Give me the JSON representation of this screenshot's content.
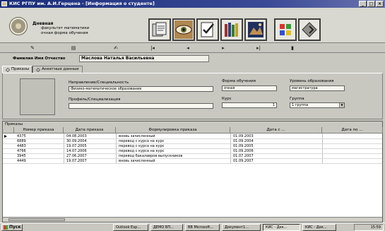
{
  "window": {
    "title": "КИС РГПУ им. А.И.Герцена - [Информация о студенте]",
    "controls": [
      "_",
      "□",
      "×"
    ]
  },
  "header": {
    "line1": "Дневная",
    "line2": "факультет математики",
    "line3": "очная форма обучения",
    "nav_icons": [
      "documents-icon",
      "eye-icon",
      "check-form-icon",
      "books-icon",
      "painting-icon",
      "windows-icon",
      "navigate-icon"
    ]
  },
  "toolbar": {
    "buttons": [
      "edit-record-icon",
      "print-icon",
      "sign-icon",
      "first-record-icon",
      "prev-record-icon",
      "next-record-icon",
      "last-record-icon",
      "delete-record-icon"
    ]
  },
  "student": {
    "fio_label": "Фамилия Имя Отчество",
    "fio_value": "Маслова Наталья Васильевна"
  },
  "tabs": [
    {
      "label": "Приказы",
      "active": true
    },
    {
      "label": "Анкетные данные",
      "active": false
    }
  ],
  "form": {
    "direction_label": "Направление/Специальность",
    "direction_value": "Физико-математическое образование",
    "profile_label": "Профиль/Специализация",
    "profile_value": "",
    "study_form_label": "Форма обучения",
    "study_form_value": "очная",
    "course_label": "Курс",
    "course_value": "1",
    "level_label": "Уровень образования",
    "level_value": "магистратура",
    "group_label": "Группа",
    "group_value": "1 группа"
  },
  "orders": {
    "title": "Приказы",
    "columns": [
      "Номер приказа",
      "Дата приказа",
      "Формулировка приказа",
      "Дата с ...",
      "Дата по ..."
    ],
    "rows": [
      {
        "num": "4375",
        "date": "04.08.2003",
        "text": "вновь зачисленный",
        "from": "01.09.2003",
        "to": "",
        "current": true
      },
      {
        "num": "6889",
        "date": "30.09.2004",
        "text": "перевод с курса на курс",
        "from": "01.09.2004",
        "to": "",
        "current": false
      },
      {
        "num": "4483",
        "date": "19.07.2005",
        "text": "перевод с курса на курс",
        "from": "01.09.2005",
        "to": "",
        "current": false
      },
      {
        "num": "4766",
        "date": "14.07.2006",
        "text": "перевод с курса на курс",
        "from": "01.09.2006",
        "to": "",
        "current": false
      },
      {
        "num": "3945",
        "date": "27.06.2007",
        "text": "перевод бакалавров выпускников",
        "from": "01.07.2007",
        "to": "",
        "current": false
      },
      {
        "num": "4449",
        "date": "19.07.2007",
        "text": "вновь зачисленный",
        "from": "01.09.2007",
        "to": "",
        "current": false
      }
    ]
  },
  "taskbar": {
    "start": "Пуск",
    "items": [
      {
        "label": "Outlook Exp...",
        "pressed": false
      },
      {
        "label": "ДЕМО ВП...",
        "pressed": false
      },
      {
        "label": "ВВ Microsoft...",
        "pressed": false
      },
      {
        "label": "Документ1...",
        "pressed": false
      },
      {
        "label": "КИС - Дек...",
        "pressed": true
      },
      {
        "label": "КИС - Дек...",
        "pressed": false
      }
    ],
    "clock": "15:59"
  }
}
